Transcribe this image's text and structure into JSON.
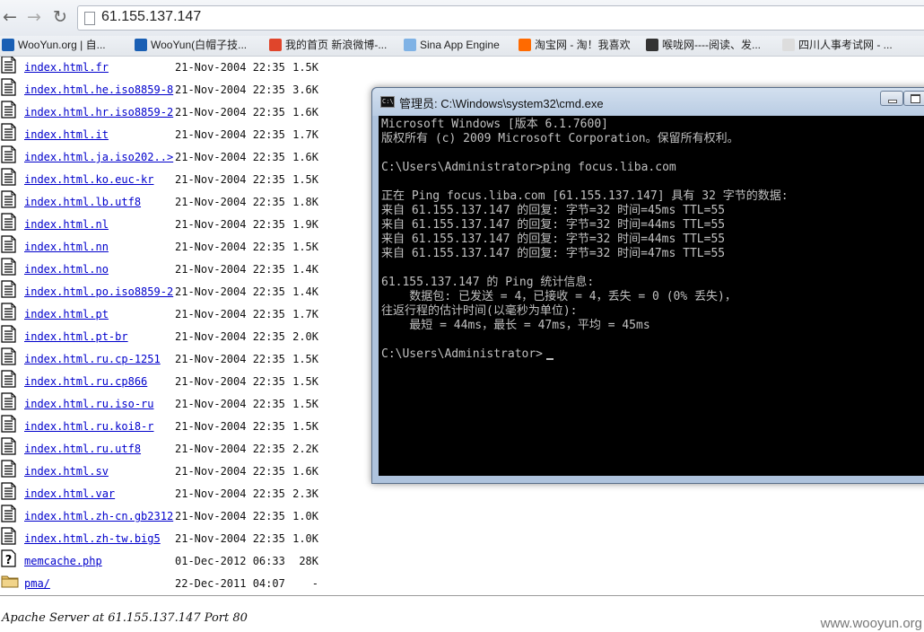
{
  "browser": {
    "back": "←",
    "forward": "→",
    "reload": "↻",
    "url": "61.155.137.147"
  },
  "bookmarks": [
    {
      "label": "WooYun.org | 自...",
      "color": "#1a5fb4"
    },
    {
      "label": "WooYun(白帽子技...",
      "color": "#1a5fb4"
    },
    {
      "label": "我的首页 新浪微博-...",
      "color": "#e0452b"
    },
    {
      "label": "Sina App Engine",
      "color": "#7fb2e5"
    },
    {
      "label": "淘宝网 - 淘！我喜欢",
      "color": "#ff6a00"
    },
    {
      "label": "喉咙网----阅读、发...",
      "color": "#333333"
    },
    {
      "label": "四川人事考试网 - ...",
      "color": "#dddddd"
    }
  ],
  "listing": [
    {
      "name": "index.html.fr",
      "date": "21-Nov-2004 22:35",
      "size": "1.5K",
      "icon": "text-file-icon"
    },
    {
      "name": "index.html.he.iso8859-8",
      "date": "21-Nov-2004 22:35",
      "size": "3.6K",
      "icon": "text-file-icon"
    },
    {
      "name": "index.html.hr.iso8859-2",
      "date": "21-Nov-2004 22:35",
      "size": "1.6K",
      "icon": "text-file-icon"
    },
    {
      "name": "index.html.it",
      "date": "21-Nov-2004 22:35",
      "size": "1.7K",
      "icon": "text-file-icon"
    },
    {
      "name": "index.html.ja.iso202..>",
      "date": "21-Nov-2004 22:35",
      "size": "1.6K",
      "icon": "text-file-icon"
    },
    {
      "name": "index.html.ko.euc-kr",
      "date": "21-Nov-2004 22:35",
      "size": "1.5K",
      "icon": "text-file-icon"
    },
    {
      "name": "index.html.lb.utf8",
      "date": "21-Nov-2004 22:35",
      "size": "1.8K",
      "icon": "text-file-icon"
    },
    {
      "name": "index.html.nl",
      "date": "21-Nov-2004 22:35",
      "size": "1.9K",
      "icon": "text-file-icon"
    },
    {
      "name": "index.html.nn",
      "date": "21-Nov-2004 22:35",
      "size": "1.5K",
      "icon": "text-file-icon"
    },
    {
      "name": "index.html.no",
      "date": "21-Nov-2004 22:35",
      "size": "1.4K",
      "icon": "text-file-icon"
    },
    {
      "name": "index.html.po.iso8859-2",
      "date": "21-Nov-2004 22:35",
      "size": "1.4K",
      "icon": "text-file-icon"
    },
    {
      "name": "index.html.pt",
      "date": "21-Nov-2004 22:35",
      "size": "1.7K",
      "icon": "text-file-icon"
    },
    {
      "name": "index.html.pt-br",
      "date": "21-Nov-2004 22:35",
      "size": "2.0K",
      "icon": "text-file-icon"
    },
    {
      "name": "index.html.ru.cp-1251",
      "date": "21-Nov-2004 22:35",
      "size": "1.5K",
      "icon": "text-file-icon"
    },
    {
      "name": "index.html.ru.cp866",
      "date": "21-Nov-2004 22:35",
      "size": "1.5K",
      "icon": "text-file-icon"
    },
    {
      "name": "index.html.ru.iso-ru",
      "date": "21-Nov-2004 22:35",
      "size": "1.5K",
      "icon": "text-file-icon"
    },
    {
      "name": "index.html.ru.koi8-r",
      "date": "21-Nov-2004 22:35",
      "size": "1.5K",
      "icon": "text-file-icon"
    },
    {
      "name": "index.html.ru.utf8",
      "date": "21-Nov-2004 22:35",
      "size": "2.2K",
      "icon": "text-file-icon"
    },
    {
      "name": "index.html.sv",
      "date": "21-Nov-2004 22:35",
      "size": "1.6K",
      "icon": "text-file-icon"
    },
    {
      "name": "index.html.var",
      "date": "21-Nov-2004 22:35",
      "size": "2.3K",
      "icon": "text-file-icon"
    },
    {
      "name": "index.html.zh-cn.gb2312",
      "date": "21-Nov-2004 22:35",
      "size": "1.0K",
      "icon": "text-file-icon"
    },
    {
      "name": "index.html.zh-tw.big5",
      "date": "21-Nov-2004 22:35",
      "size": "1.0K",
      "icon": "text-file-icon"
    },
    {
      "name": "memcache.php",
      "date": "01-Dec-2012 06:33",
      "size": "28K",
      "icon": "unknown-file-icon"
    },
    {
      "name": "pma/",
      "date": "22-Dec-2011 04:07",
      "size": "-",
      "icon": "folder-icon"
    }
  ],
  "footer": "Apache Server at 61.155.137.147 Port 80",
  "watermark": "www.wooyun.org",
  "cmd": {
    "title": "管理员: C:\\Windows\\system32\\cmd.exe",
    "icon_text": "C:\\",
    "lines": [
      "Microsoft Windows [版本 6.1.7600]",
      "版权所有 (c) 2009 Microsoft Corporation。保留所有权利。",
      "",
      "C:\\Users\\Administrator>ping focus.liba.com",
      "",
      "正在 Ping focus.liba.com [61.155.137.147] 具有 32 字节的数据:",
      "来自 61.155.137.147 的回复: 字节=32 时间=45ms TTL=55",
      "来自 61.155.137.147 的回复: 字节=32 时间=44ms TTL=55",
      "来自 61.155.137.147 的回复: 字节=32 时间=44ms TTL=55",
      "来自 61.155.137.147 的回复: 字节=32 时间=47ms TTL=55",
      "",
      "61.155.137.147 的 Ping 统计信息:",
      "    数据包: 已发送 = 4，已接收 = 4，丢失 = 0 (0% 丢失)，",
      "往返行程的估计时间(以毫秒为单位):",
      "    最短 = 44ms，最长 = 47ms，平均 = 45ms",
      "",
      "C:\\Users\\Administrator>"
    ]
  }
}
